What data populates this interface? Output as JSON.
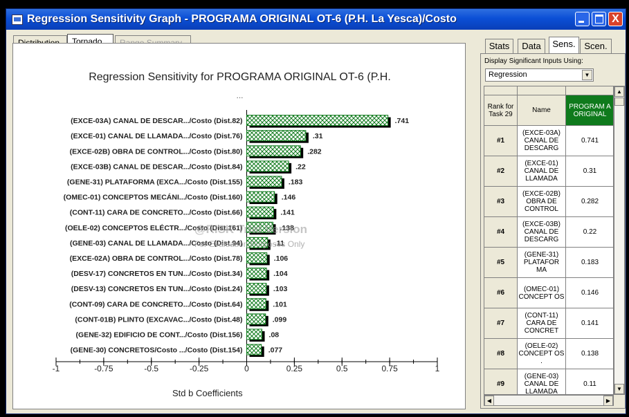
{
  "window": {
    "title": "Regression Sensitivity Graph - PROGRAMA ORIGINAL OT-6 (P.H. La Yesca)/Costo",
    "close_glyph": "X"
  },
  "left_tabs": [
    {
      "label": "Distribution"
    },
    {
      "label": "Tornado"
    },
    {
      "label": "Range Summary"
    }
  ],
  "chart": {
    "title": "Regression Sensitivity for PROGRAMA ORIGINAL OT-6 (P.H.",
    "subtitle": "...",
    "watermark_line1": "@RISK Trial Version",
    "watermark_line2": "For Evaluation Purposes Only"
  },
  "chart_data": {
    "type": "bar",
    "orientation": "horizontal",
    "xlabel": "Std b Coefficients",
    "xlim": [
      -1,
      1
    ],
    "xticks": [
      "-1",
      "-0.75",
      "-0.5",
      "-0.25",
      "0",
      "0.25",
      "0.5",
      "0.75",
      "1"
    ],
    "tick_values": [
      -1,
      -0.75,
      -0.5,
      -0.25,
      0,
      0.25,
      0.5,
      0.75,
      1
    ],
    "bar_color": "#0f7a1c",
    "categories": [
      "(EXCE-03A) CANAL DE DESCAR.../Costo (Dist.82)",
      "(EXCE-01) CANAL DE LLAMADA.../Costo (Dist.76)",
      "(EXCE-02B) OBRA DE CONTROL.../Costo (Dist.80)",
      "(EXCE-03B) CANAL DE DESCAR.../Costo (Dist.84)",
      "(GENE-31) PLATAFORMA (EXCA.../Costo (Dist.155)",
      "(OMEC-01) CONCEPTOS MECÁNI.../Costo (Dist.160)",
      "(CONT-11) CARA DE CONCRETO.../Costo (Dist.66)",
      "(OELE-02) CONCEPTOS ELÉCTR.../Costo (Dist.161)",
      "(GENE-03) CANAL DE LLAMADA.../Costo (Dist.94)",
      "(EXCE-02A) OBRA DE CONTROL.../Costo (Dist.78)",
      "(DESV-17) CONCRETOS EN TUN.../Costo (Dist.34)",
      "(DESV-13) CONCRETOS EN TUN.../Costo (Dist.24)",
      "(CONT-09) CARA DE CONCRETO.../Costo (Dist.64)",
      "(CONT-01B) PLINTO (EXCAVAC.../Costo (Dist.48)",
      "(GENE-32) EDIFICIO DE CONT.../Costo (Dist.156)",
      "(GENE-30) CONCRETOS/Costo .../Costo (Dist.154)"
    ],
    "values": [
      0.741,
      0.31,
      0.282,
      0.22,
      0.183,
      0.146,
      0.141,
      0.138,
      0.11,
      0.106,
      0.104,
      0.103,
      0.101,
      0.099,
      0.08,
      0.077
    ],
    "labels": [
      ".741",
      ".31",
      ".282",
      ".22",
      ".183",
      ".146",
      ".141",
      ".138",
      ".11",
      ".106",
      ".104",
      ".103",
      ".101",
      ".099",
      ".08",
      ".077"
    ]
  },
  "right_tabs": [
    {
      "label": "Stats"
    },
    {
      "label": "Data"
    },
    {
      "label": "Sens."
    },
    {
      "label": "Scen."
    }
  ],
  "right_panel": {
    "display_label": "Display Significant Inputs Using:",
    "combo_value": "Regression",
    "combo_arrow": "▼",
    "grid_headers": [
      "Rank for Task 29",
      "Name",
      "PROGRAM A ORIGINAL"
    ],
    "rows": [
      {
        "rank": "#1",
        "name": "(EXCE-03A) CANAL DE DESCARG",
        "value": "0.741"
      },
      {
        "rank": "#2",
        "name": "(EXCE-01) CANAL DE LLAMADA",
        "value": "0.31"
      },
      {
        "rank": "#3",
        "name": "(EXCE-02B) OBRA DE CONTROL",
        "value": "0.282"
      },
      {
        "rank": "#4",
        "name": "(EXCE-03B) CANAL DE DESCARG",
        "value": "0.22"
      },
      {
        "rank": "#5",
        "name": "(GENE-31) PLATAFOR MA",
        "value": "0.183"
      },
      {
        "rank": "#6",
        "name": "(OMEC-01) CONCEPT OS",
        "value": "0.146"
      },
      {
        "rank": "#7",
        "name": "(CONT-11) CARA DE CONCRET",
        "value": "0.141"
      },
      {
        "rank": "#8",
        "name": "(OELE-02) CONCEPT OS .",
        "value": "0.138"
      },
      {
        "rank": "#9",
        "name": "(GENE-03) CANAL DE LLAMADA",
        "value": "0.11"
      }
    ],
    "scroll_up": "▲",
    "scroll_down": "▼",
    "scroll_left": "◀",
    "scroll_right": "▶"
  }
}
